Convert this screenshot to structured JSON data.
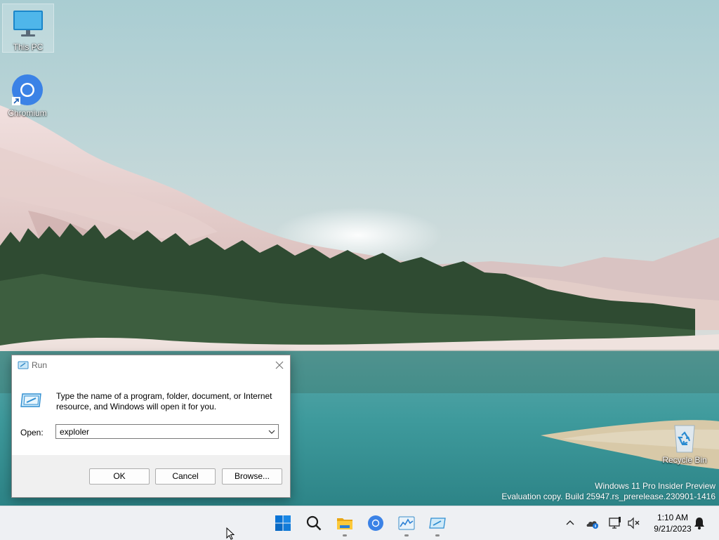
{
  "desktop": {
    "icons": [
      {
        "label": "This PC",
        "icon": "monitor-icon"
      },
      {
        "label": "Chromium",
        "icon": "chromium-icon"
      },
      {
        "label": "Recycle Bin",
        "icon": "recycle-bin-icon"
      }
    ],
    "watermark": {
      "line1": "Windows 11 Pro Insider Preview",
      "line2": "Evaluation copy. Build 25947.rs_prerelease.230901-1416"
    }
  },
  "run_dialog": {
    "title": "Run",
    "description": "Type the name of a program, folder, document, or Internet resource, and Windows will open it for you.",
    "open_label": "Open:",
    "open_value": "exploler",
    "buttons": {
      "ok": "OK",
      "cancel": "Cancel",
      "browse": "Browse..."
    },
    "icons": {
      "title": "run-icon",
      "close": "close-icon",
      "dropdown": "chevron-down-icon"
    }
  },
  "taskbar": {
    "apps": [
      {
        "name": "Start",
        "icon": "windows-start-icon",
        "running": false
      },
      {
        "name": "Search",
        "icon": "search-icon",
        "running": false
      },
      {
        "name": "File Explorer",
        "icon": "folder-icon",
        "running": true
      },
      {
        "name": "Chromium",
        "icon": "chromium-icon",
        "running": false
      },
      {
        "name": "Task Manager",
        "icon": "task-manager-icon",
        "running": true
      },
      {
        "name": "Run",
        "icon": "run-icon",
        "running": true
      }
    ],
    "tray": {
      "icons": [
        "chevron-up-icon",
        "onedrive-icon",
        "network-icon",
        "volume-muted-icon"
      ],
      "time": "1:10 AM",
      "date": "9/21/2023",
      "notification_icon": "bell-icon"
    }
  },
  "colors": {
    "accent": "#0067c0",
    "taskbar_bg": "#eef0f3",
    "dialog_footer": "#f0f0f0"
  }
}
